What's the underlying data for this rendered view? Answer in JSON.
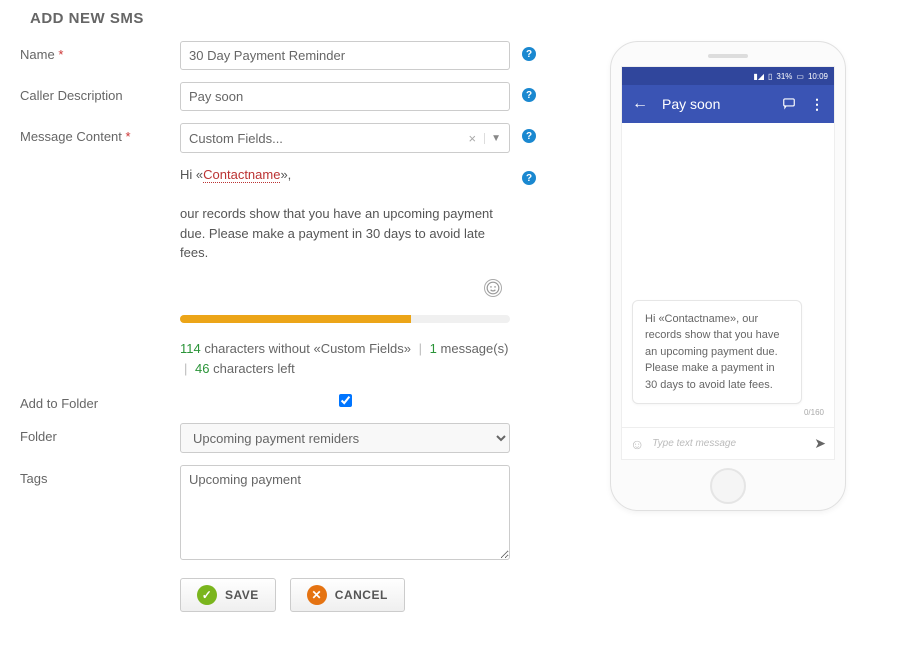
{
  "page": {
    "title": "ADD NEW SMS"
  },
  "labels": {
    "name": "Name",
    "callerDesc": "Caller Description",
    "messageContent": "Message Content",
    "addToFolder": "Add to Folder",
    "folder": "Folder",
    "tags": "Tags"
  },
  "form": {
    "name": "30 Day Payment Reminder",
    "callerDesc": "Pay soon",
    "customFieldsPlaceholder": "Custom Fields...",
    "messagePrefix": "Hi «",
    "messagePlaceholderToken": "Contactname",
    "messageSuffix": "»,\n\nour records show that you have an upcoming payment due. Please make a payment in 30 days to avoid late fees.",
    "addToFolderChecked": true,
    "folderSelected": "Upcoming payment remiders",
    "tags": "Upcoming payment"
  },
  "counter": {
    "chars": "114",
    "charsLabel": "characters without «Custom Fields»",
    "messages": "1",
    "messagesLabel": "message(s)",
    "left": "46",
    "leftLabel": "characters left",
    "progressColor": "#eca518"
  },
  "buttons": {
    "save": "SAVE",
    "cancel": "CANCEL"
  },
  "preview": {
    "statusBattery": "31%",
    "statusTime": "10:09",
    "appbarTitle": "Pay soon",
    "bubbleText": "Hi «Contactname», our records show that you have an upcoming payment due. Please make a payment in 30 days to avoid late fees.",
    "countText": "0/160",
    "composerPlaceholder": "Type text message"
  }
}
